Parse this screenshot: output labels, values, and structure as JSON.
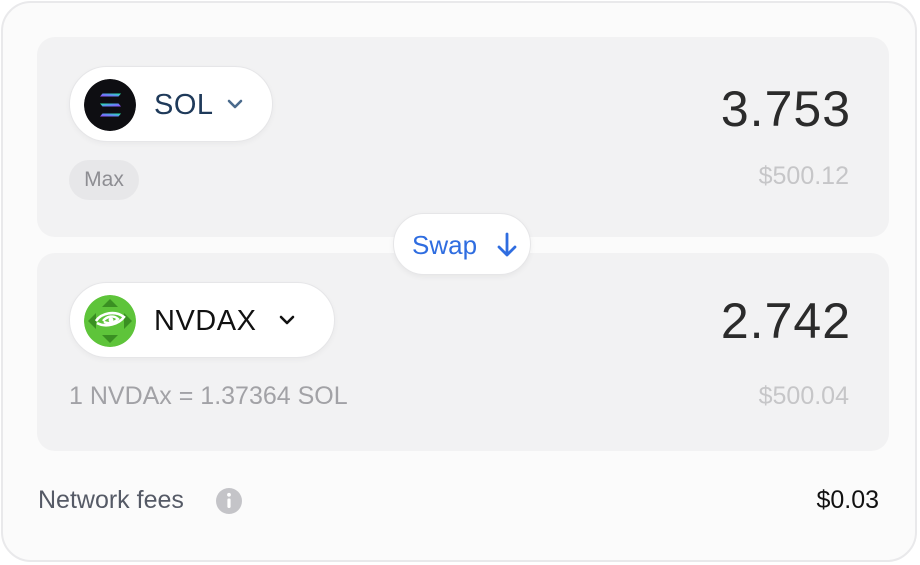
{
  "from": {
    "token": "SOL",
    "amount": "3.753",
    "usd_value": "$500.12",
    "max_label": "Max"
  },
  "swap": {
    "label": "Swap"
  },
  "to": {
    "token": "NVDAX",
    "amount": "2.742",
    "usd_value": "$500.04",
    "rate": "1 NVDAx = 1.37364 SOL"
  },
  "fees": {
    "label": "Network fees",
    "value": "$0.03"
  },
  "colors": {
    "accent": "#2f6de0",
    "nvidia_green": "#5ec43a",
    "panel_bg": "#f2f2f3"
  },
  "icons": [
    "solana-logo-icon",
    "nvidia-logo-icon",
    "chevron-down-icon",
    "arrow-down-icon",
    "info-icon"
  ]
}
